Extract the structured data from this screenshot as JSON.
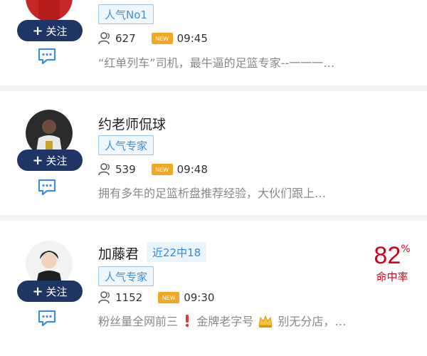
{
  "cards": [
    {
      "name": "",
      "tag": "人气No1",
      "follow_label": "关注",
      "follower_count": "627",
      "new_badge": "NEW",
      "time": "09:45",
      "description": "“红单列车”司机，最牛逼的足篮专家--一一一…"
    },
    {
      "name": "约老师侃球",
      "tag": "人气专家",
      "follow_label": "关注",
      "follower_count": "539",
      "new_badge": "NEW",
      "time": "09:48",
      "description": "拥有多年的足篮析盘推荐经验，大伙们跟上…"
    },
    {
      "name": "加藤君",
      "streak": "近22中18",
      "tag": "人气专家",
      "follow_label": "关注",
      "follower_count": "1152",
      "new_badge": "NEW",
      "time": "09:30",
      "description_part1": "粉丝量全网前三",
      "description_part2": "金牌老字号",
      "description_part3": "别无分店，…",
      "hit_rate_value": "82",
      "hit_rate_unit": "%",
      "hit_rate_label": "命中率"
    }
  ],
  "colors": {
    "follow_button": "#1f3566",
    "tag_text": "#3d8fdb",
    "new_badge": "#f5a623",
    "hit_rate": "#d0021b"
  }
}
